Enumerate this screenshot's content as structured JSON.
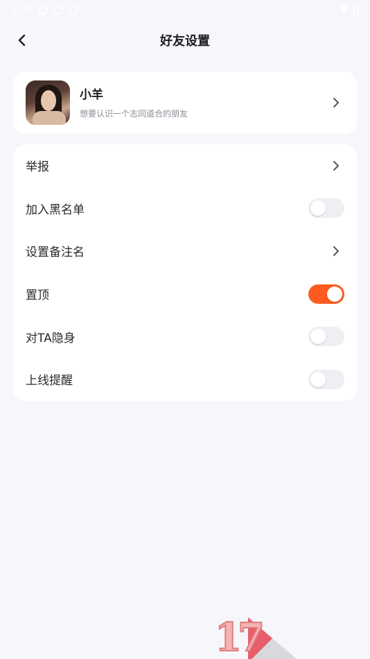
{
  "status": {
    "time": "2:09"
  },
  "header": {
    "title": "好友设置"
  },
  "profile": {
    "name": "小羊",
    "signature": "想要认识一个志同道合的朋友"
  },
  "settings": [
    {
      "label": "举报",
      "control": "chevron"
    },
    {
      "label": "加入黑名单",
      "control": "toggle",
      "on": false
    },
    {
      "label": "设置备注名",
      "control": "chevron"
    },
    {
      "label": "置顶",
      "control": "toggle",
      "on": true
    },
    {
      "label": "对TA隐身",
      "control": "toggle",
      "on": false
    },
    {
      "label": "上线提醒",
      "control": "toggle",
      "on": false
    }
  ],
  "colors": {
    "accent": "#ff5a1f",
    "background": "#f6f6fb",
    "card": "#ffffff"
  },
  "watermark": {
    "text": "17"
  }
}
